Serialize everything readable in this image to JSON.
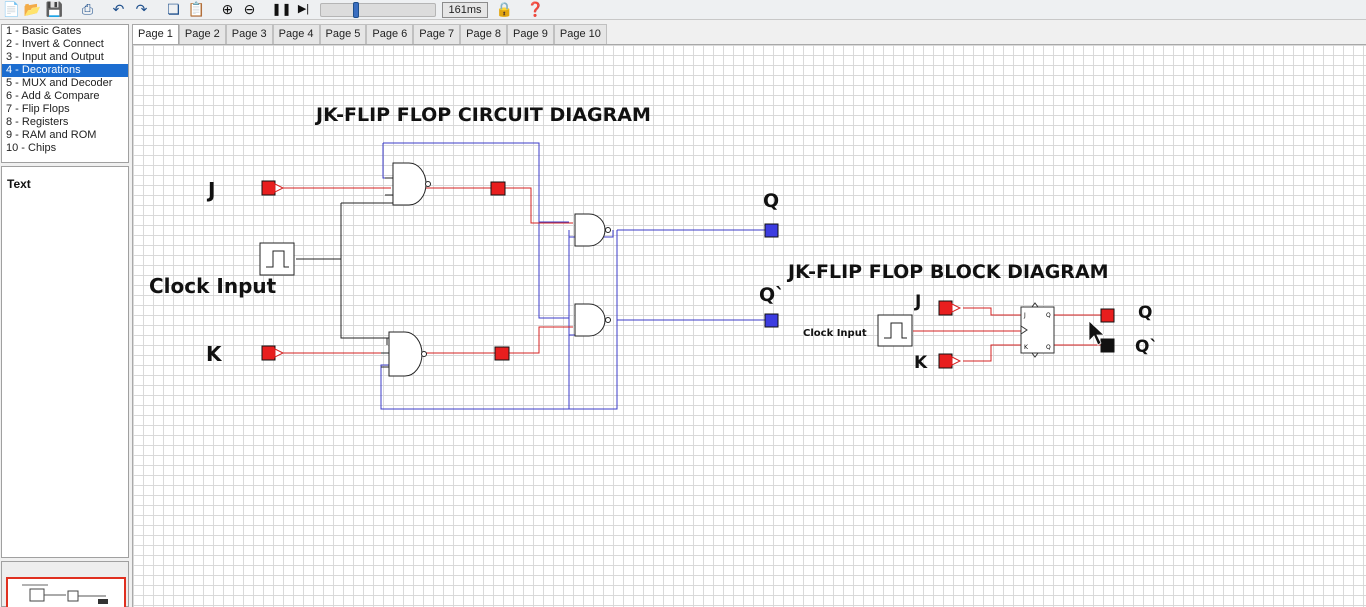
{
  "toolbar": {
    "speed": "161ms",
    "speed_fraction": 0.3,
    "icons": [
      "new-icon",
      "open-icon",
      "save-icon",
      "print-icon",
      "undo-icon",
      "redo-icon",
      "copy-icon",
      "paste-icon",
      "zoom-in-icon",
      "zoom-out-icon",
      "pause-icon",
      "step-icon",
      "lock-icon",
      "help-icon"
    ]
  },
  "sidebar": {
    "items": [
      {
        "label": "1  - Basic Gates"
      },
      {
        "label": "2  - Invert & Connect"
      },
      {
        "label": "3  - Input and Output"
      },
      {
        "label": "4  - Decorations"
      },
      {
        "label": "5  - MUX and Decoder"
      },
      {
        "label": "6  - Add & Compare"
      },
      {
        "label": "7  - Flip Flops"
      },
      {
        "label": "8  - Registers"
      },
      {
        "label": "9  - RAM and ROM"
      },
      {
        "label": "10 - Chips"
      }
    ],
    "selected_index": 3,
    "properties_title": "Text"
  },
  "tabs": [
    "Page 1",
    "Page 2",
    "Page 3",
    "Page 4",
    "Page 5",
    "Page 6",
    "Page 7",
    "Page 8",
    "Page 9",
    "Page 10"
  ],
  "active_tab": 0,
  "canvas": {
    "title_circuit": "JK-FLIP FLOP CIRCUIT DIAGRAM",
    "title_block": "JK-FLIP FLOP BLOCK DIAGRAM",
    "label_j": "J",
    "label_k": "K",
    "label_clock": "Clock Input",
    "label_q": "Q",
    "label_qbar": "Q`",
    "block_label_j": "J",
    "block_label_k": "K",
    "block_label_clock": "Clock Input",
    "block_label_q": "Q",
    "block_label_qbar": "Q`",
    "ff_pin_j": "J",
    "ff_pin_k": "K",
    "ff_pin_q": "Q",
    "ff_pin_qbar": "Q"
  },
  "colors": {
    "wire_active": "#d42020",
    "wire_inactive": "#3b3bc8",
    "io_on": "#e81e1e",
    "io_output": "#3c3ce0",
    "io_off": "#111111",
    "selection": "#1c6dd0"
  }
}
